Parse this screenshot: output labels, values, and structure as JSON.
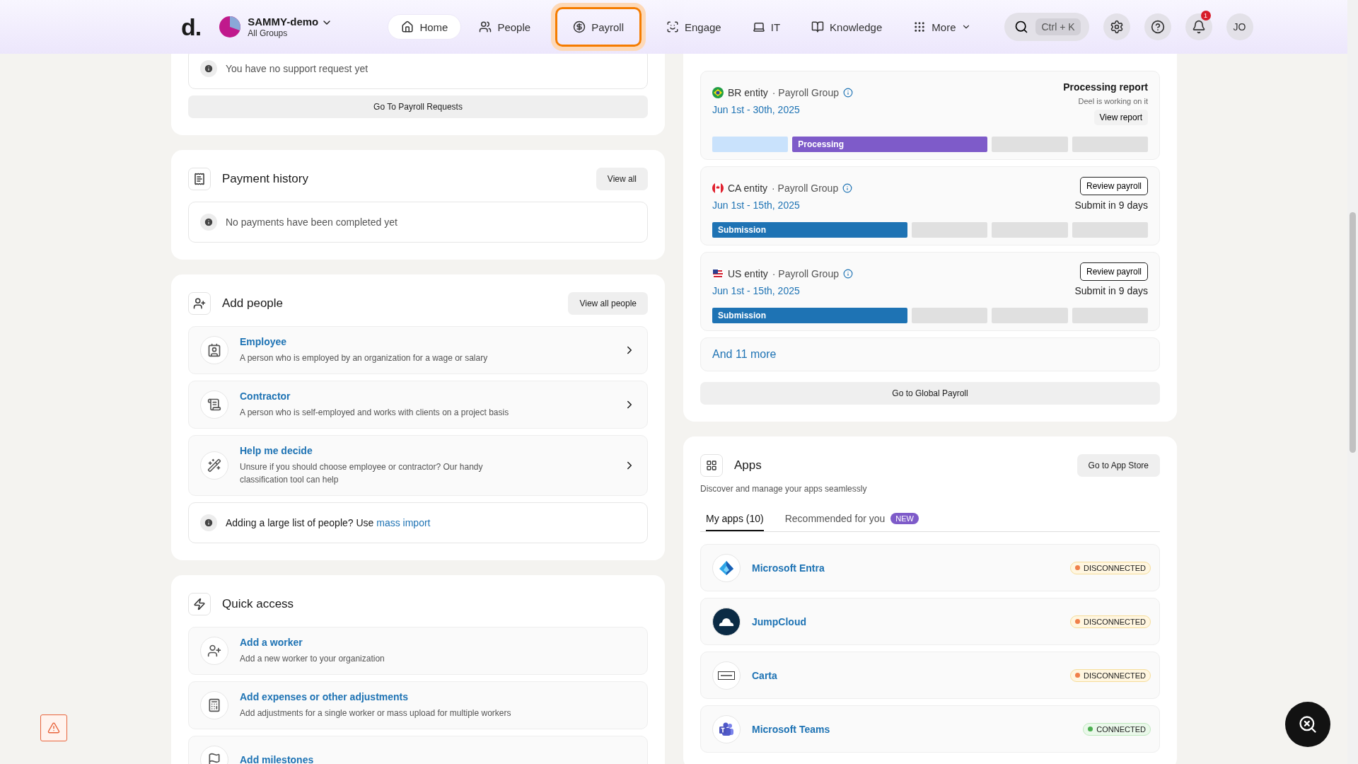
{
  "header": {
    "logo": "d.",
    "org": {
      "name": "SAMMY-demo",
      "sub": "All Groups"
    },
    "nav": [
      {
        "label": "Home",
        "selected": true,
        "focused": false
      },
      {
        "label": "People",
        "selected": false,
        "focused": false
      },
      {
        "label": "Payroll",
        "selected": false,
        "focused": true
      },
      {
        "label": "Engage",
        "selected": false,
        "focused": false
      },
      {
        "label": "IT",
        "selected": false,
        "focused": false
      },
      {
        "label": "Knowledge",
        "selected": false,
        "focused": false
      },
      {
        "label": "More",
        "selected": false,
        "focused": false
      }
    ],
    "search": {
      "shortcut": "Ctrl + K"
    },
    "notifications": {
      "count": "1"
    },
    "avatar": {
      "initials": "JO"
    }
  },
  "payroll_requests": {
    "message": "You have no support request yet",
    "button": "Go To Payroll Requests"
  },
  "payment_history": {
    "title": "Payment history",
    "button": "View all",
    "message": "No payments have been completed yet"
  },
  "add_people": {
    "title": "Add people",
    "button": "View all people",
    "options": [
      {
        "title": "Employee",
        "description": "A person who is employed by an organization for a wage or salary"
      },
      {
        "title": "Contractor",
        "description": "A person who is self-employed and works with clients on a project basis"
      },
      {
        "title": "Help me decide",
        "description": "Unsure if you should choose employee or contractor? Our handy classification tool can help"
      }
    ],
    "note": {
      "text": "Adding a large list of people? Use",
      "link": "mass import"
    }
  },
  "quick_access": {
    "title": "Quick access",
    "items": [
      {
        "title": "Add a worker",
        "description": "Add a new worker to your organization"
      },
      {
        "title": "Add expenses or other adjustments",
        "description": "Add adjustments for a single worker or mass upload for multiple workers"
      },
      {
        "title": "Add milestones"
      }
    ]
  },
  "cycles_tracker": {
    "entities": [
      {
        "name": "BR entity",
        "group": "· Payroll Group",
        "dates": "Jun 1st - 30th, 2025",
        "status": {
          "kind": "report",
          "title": "Processing report",
          "note": "Deel is working on it",
          "button": "View report"
        },
        "segments": [
          {
            "kind": "done"
          },
          {
            "kind": "active",
            "label": "Processing",
            "color": "#7e5bc9"
          },
          {
            "kind": "pending"
          },
          {
            "kind": "pending"
          }
        ]
      },
      {
        "name": "CA entity",
        "group": "· Payroll Group",
        "dates": "Jun 1st - 15th, 2025",
        "status": {
          "kind": "review",
          "button": "Review payroll",
          "note": "Submit in 9 days"
        },
        "segments": [
          {
            "kind": "active",
            "label": "Submission",
            "color": "#1e73b4"
          },
          {
            "kind": "pending"
          },
          {
            "kind": "pending"
          },
          {
            "kind": "pending"
          }
        ]
      },
      {
        "name": "US entity",
        "group": "· Payroll Group",
        "dates": "Jun 1st - 15th, 2025",
        "status": {
          "kind": "review",
          "button": "Review payroll",
          "note": "Submit in 9 days"
        },
        "segments": [
          {
            "kind": "active",
            "label": "Submission",
            "color": "#1e73b4"
          },
          {
            "kind": "pending"
          },
          {
            "kind": "pending"
          },
          {
            "kind": "pending"
          }
        ]
      }
    ],
    "more": "And 11 more",
    "button": "Go to Global Payroll"
  },
  "apps": {
    "title": "Apps",
    "button": "Go to App Store",
    "subtitle": "Discover and manage your apps seamlessly",
    "tabs": [
      {
        "label": "My apps (10)",
        "selected": true
      },
      {
        "label": "Recommended for you",
        "badge": "NEW",
        "selected": false
      }
    ],
    "items": [
      {
        "name": "Microsoft Entra",
        "status": "DISCONNECTED",
        "connected": false
      },
      {
        "name": "JumpCloud",
        "status": "DISCONNECTED",
        "connected": false
      },
      {
        "name": "Carta",
        "status": "DISCONNECTED",
        "connected": false
      },
      {
        "name": "Microsoft Teams",
        "status": "CONNECTED",
        "connected": true
      }
    ]
  }
}
